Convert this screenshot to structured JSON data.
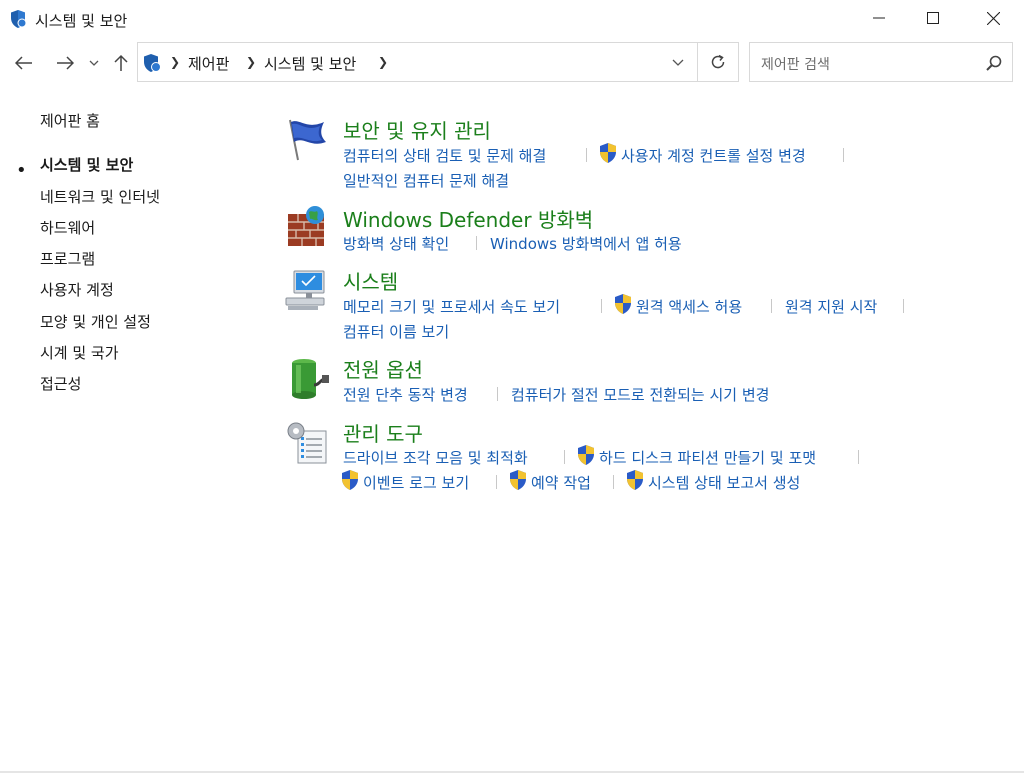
{
  "window": {
    "title": "시스템 및 보안"
  },
  "nav": {
    "breadcrumb": [
      "제어판",
      "시스템 및 보안"
    ],
    "search_placeholder": "제어판 검색"
  },
  "sidebar": {
    "items": [
      {
        "label": "제어판 홈"
      },
      {
        "label": "시스템 및 보안"
      },
      {
        "label": "네트워크 및 인터넷"
      },
      {
        "label": "하드웨어"
      },
      {
        "label": "프로그램"
      },
      {
        "label": "사용자 계정"
      },
      {
        "label": "모양 및 개인 설정"
      },
      {
        "label": "시계 및 국가"
      },
      {
        "label": "접근성"
      }
    ]
  },
  "categories": [
    {
      "title": "보안 및 유지 관리",
      "icon": "flag-icon",
      "links": [
        "컴퓨터의 상태 검토 및 문제 해결",
        "사용자 계정 컨트롤 설정 변경",
        "일반적인 컴퓨터 문제 해결"
      ]
    },
    {
      "title": "Windows Defender 방화벽",
      "icon": "firewall-icon",
      "links": [
        "방화벽 상태 확인",
        "Windows 방화벽에서 앱 허용"
      ]
    },
    {
      "title": "시스템",
      "icon": "computer-icon",
      "links": [
        "메모리 크기 및 프로세서 속도 보기",
        "원격 액세스 허용",
        "원격 지원 시작",
        "컴퓨터 이름 보기"
      ]
    },
    {
      "title": "전원 옵션",
      "icon": "battery-icon",
      "links": [
        "전원 단추 동작 변경",
        "컴퓨터가 절전 모드로 전환되는 시기 변경"
      ]
    },
    {
      "title": "관리 도구",
      "icon": "admin-tools-icon",
      "links": [
        "드라이브 조각 모음 및 최적화",
        "하드 디스크 파티션 만들기 및 포맷",
        "이벤트 로그 보기",
        "예약 작업",
        "시스템 상태 보고서 생성"
      ]
    }
  ],
  "colors": {
    "category_title": "#1b7f1b",
    "link": "#1a5fb4"
  }
}
